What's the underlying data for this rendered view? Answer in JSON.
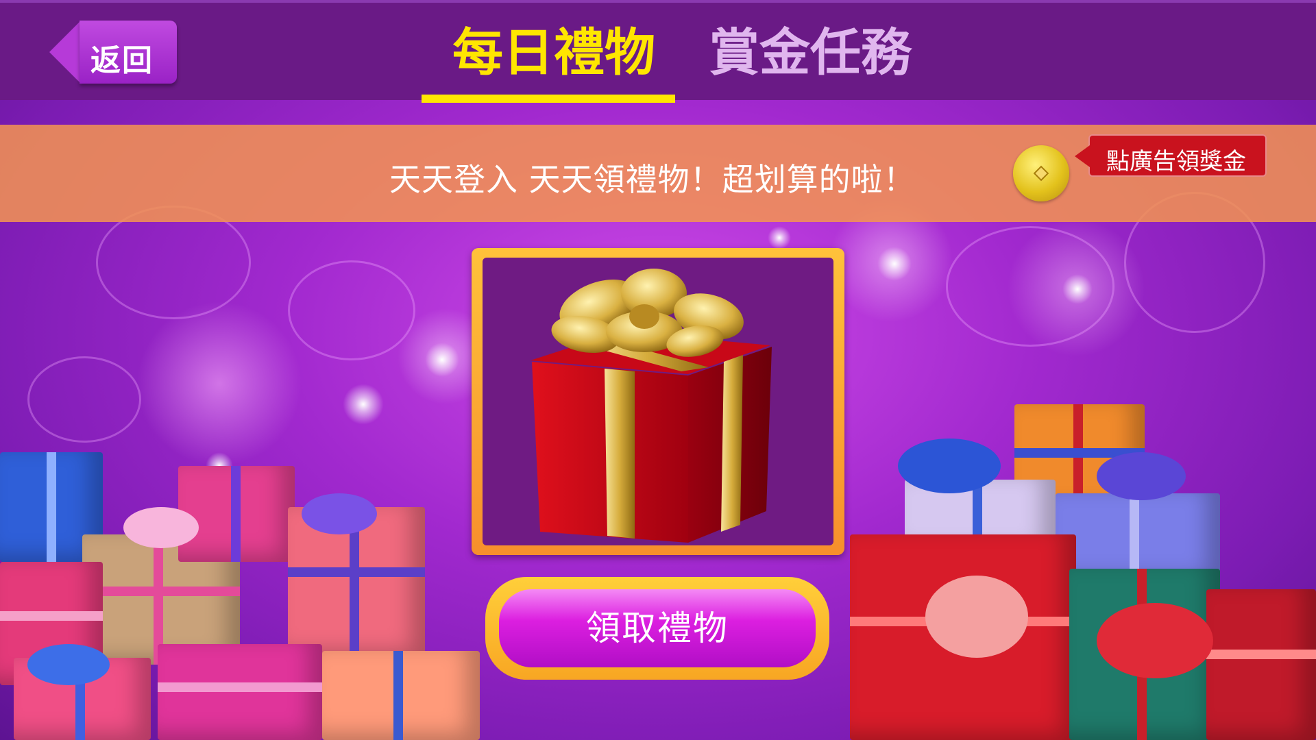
{
  "nav": {
    "back_label": "返回"
  },
  "tabs": [
    {
      "label": "每日禮物",
      "active": true
    },
    {
      "label": "賞金任務",
      "active": false
    }
  ],
  "banner": {
    "message": "天天登入 天天領禮物！超划算的啦！",
    "ad_reward_label": "點廣告領獎金"
  },
  "gift": {
    "claim_label": "領取禮物"
  },
  "colors": {
    "active_tab": "#ffe600",
    "inactive_tab": "#e0b6ee",
    "topbar": "#6a1a86",
    "banner": "#f39452",
    "ad_tag": "#c9121e",
    "claim_button": "#dc1fe0",
    "gift_frame": "#ffc23a"
  },
  "icons": {
    "coin": "gold-coin-icon",
    "gift": "gift-box-icon",
    "back": "back-arrow-icon"
  }
}
